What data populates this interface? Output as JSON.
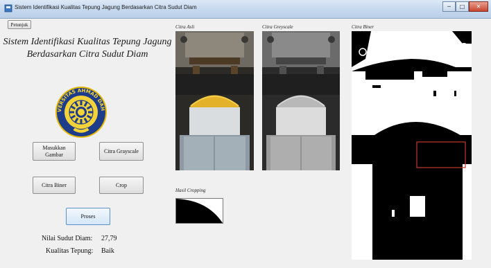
{
  "window": {
    "title": "Sistem Identifikasi Kualitas Tepung Jagung Berdasarkan Citra Sudut Diam",
    "controls": {
      "minimize": "─",
      "maximize": "□",
      "close": "✕"
    }
  },
  "toolbar": {
    "help_label": "Petunjuk"
  },
  "header": {
    "title_line1": "Sistem Identifikasi Kualitas Tepung Jagung",
    "title_line2": "Berdasarkan Citra Sudut Diam"
  },
  "logo": {
    "text": "UNIVERSITAS AHMAD DAHLAN",
    "colors": {
      "ring": "#1d3c8a",
      "gold": "#e6b800"
    }
  },
  "buttons": {
    "load": "Masukkan Gambar",
    "grayscale": "Citra Grayscale",
    "binary": "Citra Biner",
    "crop": "Crop",
    "process": "Proses"
  },
  "results": {
    "angle_label": "Nilai Sudut Diam:",
    "angle_value": "27,79",
    "quality_label": "Kualitas Tepung:",
    "quality_value": "Baik"
  },
  "panels": {
    "original": "Citra Asli",
    "grayscale": "Citra Greyscale",
    "binary": "Citra Biner",
    "cropped": "Hasil Cropping"
  }
}
